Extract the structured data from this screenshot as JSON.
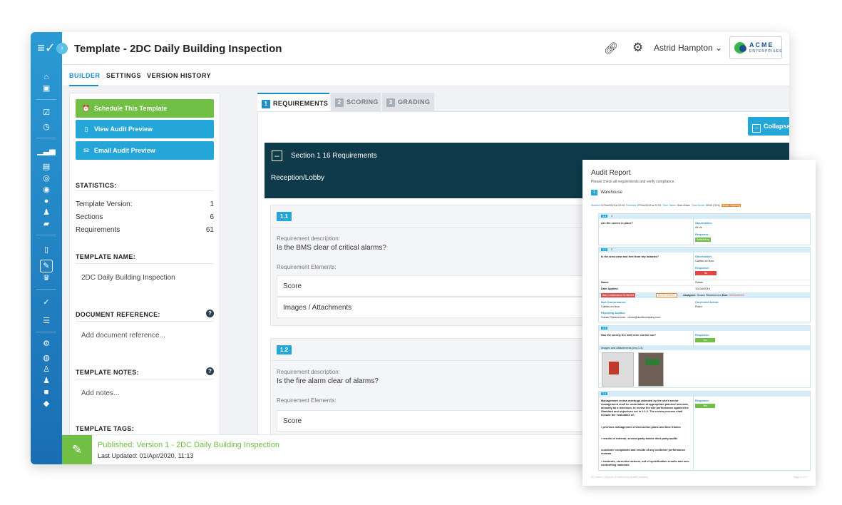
{
  "header": {
    "title": "Template - 2DC Daily Building Inspection",
    "user_name": "Astrid Hampton",
    "brand_name": "ACME",
    "brand_sub": "ENTERPRISES"
  },
  "subtabs": [
    "BUILDER",
    "SETTINGS",
    "VERSION HISTORY"
  ],
  "actions": {
    "schedule": "Schedule This Template",
    "view_preview": "View Audit Preview",
    "email_preview": "Email Audit Preview"
  },
  "statistics": {
    "heading": "STATISTICS:",
    "rows": [
      {
        "label": "Template Version:",
        "value": "1"
      },
      {
        "label": "Sections",
        "value": "6"
      },
      {
        "label": "Requirements",
        "value": "61"
      }
    ]
  },
  "template_name": {
    "heading": "TEMPLATE NAME:",
    "value": "2DC Daily Building Inspection"
  },
  "doc_ref": {
    "heading": "DOCUMENT REFERENCE:",
    "placeholder": "Add document reference..."
  },
  "notes": {
    "heading": "TEMPLATE NOTES:",
    "placeholder": "Add notes..."
  },
  "tags": {
    "heading": "TEMPLATE TAGS:"
  },
  "main_tabs": [
    {
      "num": "1",
      "label": "REQUIREMENTS"
    },
    {
      "num": "2",
      "label": "SCORING"
    },
    {
      "num": "3",
      "label": "GRADING"
    }
  ],
  "collapse_label": "Collapse All",
  "section": {
    "title": "Section 1   16 Requirements",
    "subtitle": "Reception/Lobby"
  },
  "requirements": [
    {
      "num": "1.1",
      "desc_label": "Requirement description:",
      "question": "Is the BMS clear of critical alarms?",
      "elements_label": "Requirement Elements:",
      "elements": [
        "Score",
        "Images / Attachments"
      ]
    },
    {
      "num": "1.2",
      "desc_label": "Requirement description:",
      "question": "Is the fire alarm clear of alarms?",
      "elements_label": "Requirement Elements:",
      "elements": [
        "Score"
      ]
    }
  ],
  "footer": {
    "published": "Published: Version 1 - 2DC Daily Building Inspection",
    "updated": "Last Updated: 01/Apr/2020, 11:13"
  },
  "report": {
    "title": "Audit Report",
    "subtitle": "Please check all requirements and verify compliance.",
    "section_num": "1",
    "section_name": "Warehouse",
    "meta_started_k": "Started:",
    "meta_started": "07/Oct/2019 at 22:03",
    "meta_finished_k": "Finished:",
    "meta_finished": "07/Oct/2019 at 22:51",
    "meta_time_k": "Time Taken:",
    "meta_time": "3min 40sec",
    "meta_score_k": "Total Score:",
    "meta_score": "30/40 (75%)",
    "meta_grade": "Grade: Warning",
    "r1_num": "1.1",
    "r1_idx": "1",
    "r1_q": "Are the covers in place?",
    "r1_obs_k": "Observation:",
    "r1_obs": "All ok",
    "r1_resp_k": "Response:",
    "r1_resp": "Satisfactory",
    "r2_num": "1.2",
    "r2_idx": "2",
    "r2_q": "Is the area clear and free from trip hazards?",
    "r2_obs_k": "Observation:",
    "r2_obs": "Cables on floor",
    "r2_resp_k": "Response:",
    "r2_resp": "No",
    "name_k": "Name",
    "name_v": "Susan",
    "date_k": "Date Applied",
    "date_v": "11/Oct/2019",
    "nc_id": "Non-Conformance ID:381263",
    "nc_status": "IN PROGRESS",
    "nc_assignee_k": "Assignee:",
    "nc_assignee": "Susan Fitzsimmons",
    "nc_due_k": "Due:",
    "nc_due": "09/Oct/2019",
    "nc_k": "Non-Conformance:",
    "nc_v": "Cables on floor",
    "ca_k": "Corrective Action:",
    "ca_v": "Fixed",
    "auditor_k": "Reporting Auditor:",
    "auditor_v": "Susan Fitzsimmons - demo@auditcompany.com",
    "r3_num": "1.3",
    "r3_q": "Has the weekly fire drill been carried out?",
    "r3_resp_k": "Response:",
    "r3_resp": "Yes",
    "r3_images": "Images and Attachments (req 1.3)",
    "r4_num": "1.4",
    "r4_q": "Management review meetings attended by the site's senior management shall be undertaken at appropriate planned intervals, annually as a minimum, to review the site performance against the Standard and objectives set in 1.1.2. The review process shall include the evaluation of:",
    "r4_b1": "• previous management review action plans and time frames",
    "r4_b2": "• results of internal, second party and/or third party audits",
    "r4_b3": "•customer complaints and results of any customer performance reviews",
    "r4_b4": "• incidents, corrective actions, out of specification results and non-conforming materials",
    "r4_resp_k": "Response:",
    "r4_resp": "Yes",
    "footer_left": "AC Demo | Report | Powered by AuditCompany",
    "footer_right": "Page 1 of 7"
  },
  "colors": {
    "accent": "#1d8fc7",
    "green": "#71bf44",
    "section": "#0f3a4a"
  }
}
